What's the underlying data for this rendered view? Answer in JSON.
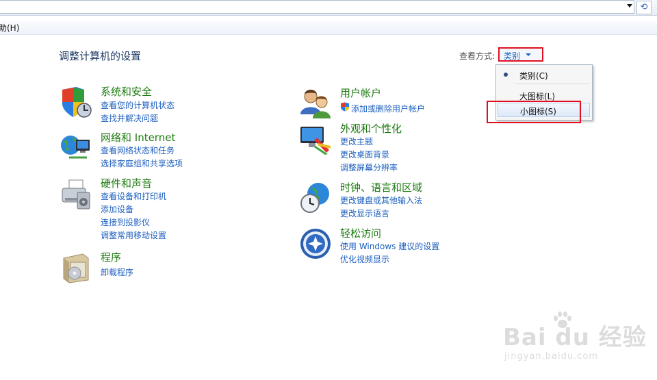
{
  "menubar": {
    "help": "助(H)"
  },
  "header": {
    "title": "调整计算机的设置"
  },
  "view": {
    "label": "查看方式:",
    "current": "类别"
  },
  "dropdown": {
    "items": [
      {
        "label": "类别(C)",
        "selected": true
      },
      {
        "label": "大图标(L)",
        "selected": false
      },
      {
        "label": "小图标(S)",
        "selected": false
      }
    ]
  },
  "categories": [
    {
      "id": "system",
      "title": "系统和安全",
      "icon": "shield-icon",
      "links": [
        "查看您的计算机状态",
        "查找并解决问题"
      ]
    },
    {
      "id": "network",
      "title": "网络和 Internet",
      "icon": "network-globe-icon",
      "links": [
        "查看网络状态和任务",
        "选择家庭组和共享选项"
      ]
    },
    {
      "id": "hardware",
      "title": "硬件和声音",
      "icon": "printer-icon",
      "links": [
        "查看设备和打印机",
        "添加设备",
        "连接到投影仪",
        "调整常用移动设置"
      ]
    },
    {
      "id": "programs",
      "title": "程序",
      "icon": "programs-box-icon",
      "links": [
        "卸载程序"
      ]
    },
    {
      "id": "users",
      "title": "用户帐户",
      "icon": "users-icon",
      "links": [
        "添加或删除用户帐户"
      ]
    },
    {
      "id": "appearance",
      "title": "外观和个性化",
      "icon": "monitor-paint-icon",
      "links": [
        "更改主题",
        "更改桌面背景",
        "调整屏幕分辨率"
      ]
    },
    {
      "id": "clock",
      "title": "时钟、语言和区域",
      "icon": "clock-globe-icon",
      "links": [
        "更改键盘或其他输入法",
        "更改显示语言"
      ]
    },
    {
      "id": "ease",
      "title": "轻松访问",
      "icon": "ease-of-access-icon",
      "links": [
        "使用 Windows 建议的设置",
        "优化视频显示"
      ]
    }
  ],
  "watermark": {
    "main": "Bai du 经验",
    "sub": "jingyan.baidu.com"
  },
  "colors": {
    "accent_link": "#1d5fbf",
    "category_title": "#1c7a10",
    "highlight_box": "#e01020"
  }
}
